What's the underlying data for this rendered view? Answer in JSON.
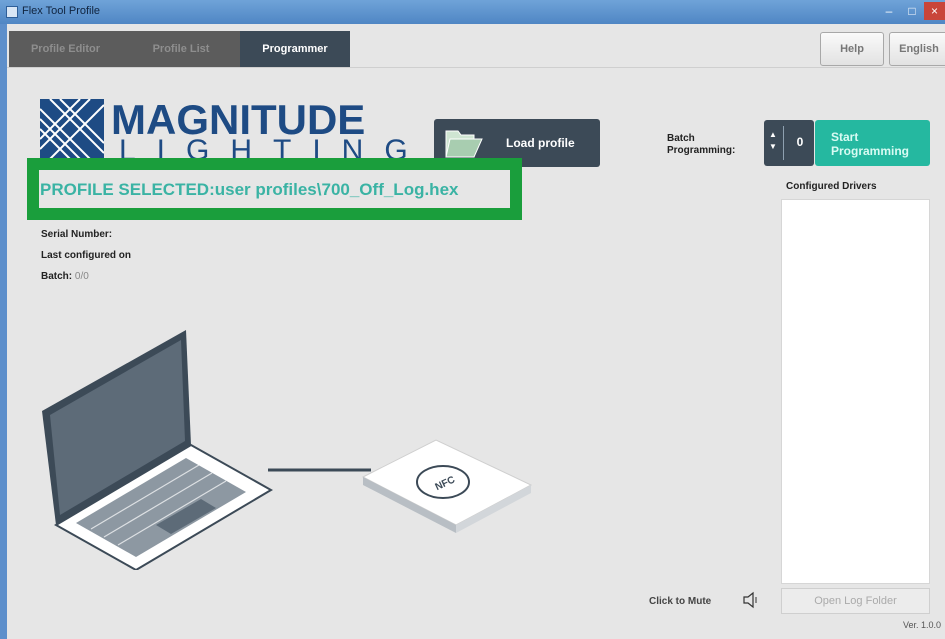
{
  "window": {
    "title": "Flex Tool Profile"
  },
  "tabs": [
    {
      "label": "Profile Editor",
      "active": false
    },
    {
      "label": "Profile List",
      "active": false
    },
    {
      "label": "Programmer",
      "active": true
    }
  ],
  "header": {
    "help_label": "Help",
    "language_label": "English"
  },
  "logo": {
    "word": "MAGNITUDE",
    "sub": "LIGHTING"
  },
  "actions": {
    "load_profile_label": "Load profile",
    "batch_label_line1": "Batch",
    "batch_label_line2": "Programming:",
    "batch_value": "0",
    "start_line1": "Start",
    "start_line2": "Programming"
  },
  "profile": {
    "selected_text": "PROFILE SELECTED:user profiles\\700_Off_Log.hex"
  },
  "info": {
    "serial_label": "Serial Number:",
    "last_configured_label": "Last configured on",
    "batch_label": "Batch:",
    "batch_value": "0/0"
  },
  "drivers": {
    "title": "Configured Drivers",
    "open_log_label": "Open Log Folder"
  },
  "footer": {
    "mute_label": "Click to Mute",
    "version": "Ver. 1.0.0"
  },
  "illustration": {
    "nfc_label": "NFC"
  },
  "colors": {
    "accent": "#25b8a0",
    "dark": "#3c4a57",
    "highlight": "#1a9e3c",
    "brand": "#1e4b84"
  }
}
